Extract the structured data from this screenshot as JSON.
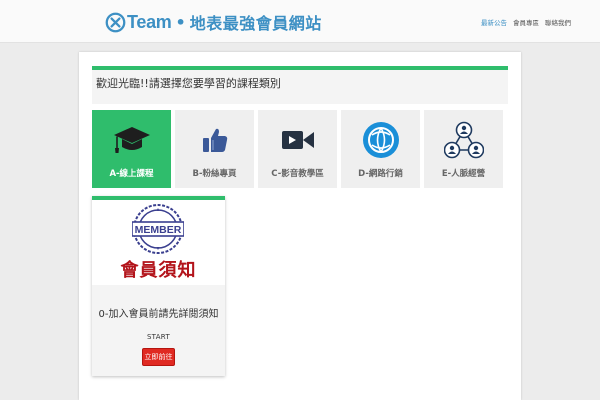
{
  "header": {
    "brand_name": "Team",
    "brand_dot": "•",
    "brand_subtitle": "地表最強會員網站",
    "nav": [
      {
        "label": "最新公告",
        "active": true
      },
      {
        "label": "會員專區",
        "active": false
      },
      {
        "label": "聯絡我們",
        "active": false
      }
    ]
  },
  "notice": {
    "text": "歡迎光臨!!請選擇您要學習的課程類別"
  },
  "tiles": [
    {
      "label": "A-線上課程",
      "icon": "graduation-cap-icon",
      "active": true
    },
    {
      "label": "B-粉絲專頁",
      "icon": "thumbs-up-icon",
      "active": false
    },
    {
      "label": "C-影音教學區",
      "icon": "video-camera-icon",
      "active": false
    },
    {
      "label": "D-網路行銷",
      "icon": "globe-icon",
      "active": false
    },
    {
      "label": "E-人脈經營",
      "icon": "network-people-icon",
      "active": false
    }
  ],
  "member_card": {
    "stamp_text": "MEMBER",
    "headline": "會員須知",
    "title": "0-加入會員前請先詳閱須知",
    "start_label": "START",
    "button_label": "立即前往"
  },
  "colors": {
    "accent_green": "#2fbd6c",
    "brand_blue": "#3d90c4",
    "button_red": "#e02a22"
  }
}
